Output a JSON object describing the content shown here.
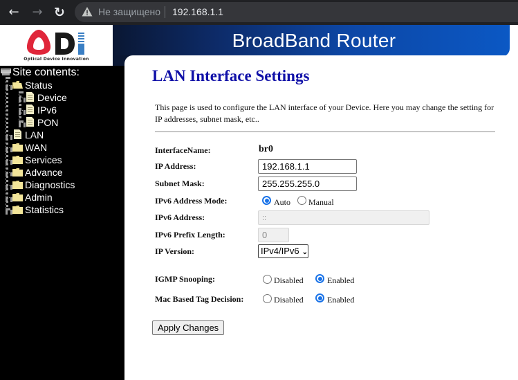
{
  "browser": {
    "security_label": "Не защищено",
    "url": "192.168.1.1",
    "icons": [
      "back-arrow-icon",
      "forward-arrow-icon",
      "reload-icon",
      "warning-icon"
    ]
  },
  "header": {
    "logo_subtitle": "Optical Device Innovation",
    "banner_title": "BroadBand Router",
    "colors": {
      "logo_red": "#e0263a",
      "logo_blue": "#3a7fc4",
      "banner_dark": "#0a1733",
      "banner_light": "#0b58c4"
    }
  },
  "sidebar": {
    "title": "Site contents:",
    "items": [
      {
        "label": "Status",
        "icon": "folder-open-icon",
        "level": 0
      },
      {
        "label": "Device",
        "icon": "document-icon",
        "level": 1
      },
      {
        "label": "IPv6",
        "icon": "document-icon",
        "level": 1
      },
      {
        "label": "PON",
        "icon": "document-icon",
        "level": 1
      },
      {
        "label": "LAN",
        "icon": "document-icon",
        "level": 0
      },
      {
        "label": "WAN",
        "icon": "folder-icon",
        "level": 0
      },
      {
        "label": "Services",
        "icon": "folder-icon",
        "level": 0
      },
      {
        "label": "Advance",
        "icon": "folder-icon",
        "level": 0
      },
      {
        "label": "Diagnostics",
        "icon": "folder-icon",
        "level": 0
      },
      {
        "label": "Admin",
        "icon": "folder-icon",
        "level": 0
      },
      {
        "label": "Statistics",
        "icon": "folder-icon",
        "level": 0
      }
    ]
  },
  "main": {
    "title": "LAN Interface Settings",
    "description": "This page is used to configure the LAN interface of your Device. Here you may change the setting for IP addresses, subnet mask, etc..",
    "fields": {
      "interface_name": {
        "label": "InterfaceName:",
        "value": "br0"
      },
      "ip_address": {
        "label": "IP Address:",
        "value": "192.168.1.1"
      },
      "subnet_mask": {
        "label": "Subnet Mask:",
        "value": "255.255.255.0"
      },
      "ipv6_mode": {
        "label": "IPv6 Address Mode:",
        "options": [
          "Auto",
          "Manual"
        ],
        "selected": "Auto"
      },
      "ipv6_address": {
        "label": "IPv6 Address:",
        "value": "::"
      },
      "ipv6_prefix": {
        "label": "IPv6 Prefix Length:",
        "value": "0"
      },
      "ip_version": {
        "label": "IP Version:",
        "value": "IPv4/IPv6"
      },
      "igmp_snooping": {
        "label": "IGMP Snooping:",
        "options": [
          "Disabled",
          "Enabled"
        ],
        "selected": "Enabled"
      },
      "mac_tag": {
        "label": "Mac Based Tag Decision:",
        "options": [
          "Disabled",
          "Enabled"
        ],
        "selected": "Enabled"
      }
    },
    "apply_label": "Apply Changes",
    "accent_color": "#1a73e8",
    "title_color": "#1111a8"
  }
}
